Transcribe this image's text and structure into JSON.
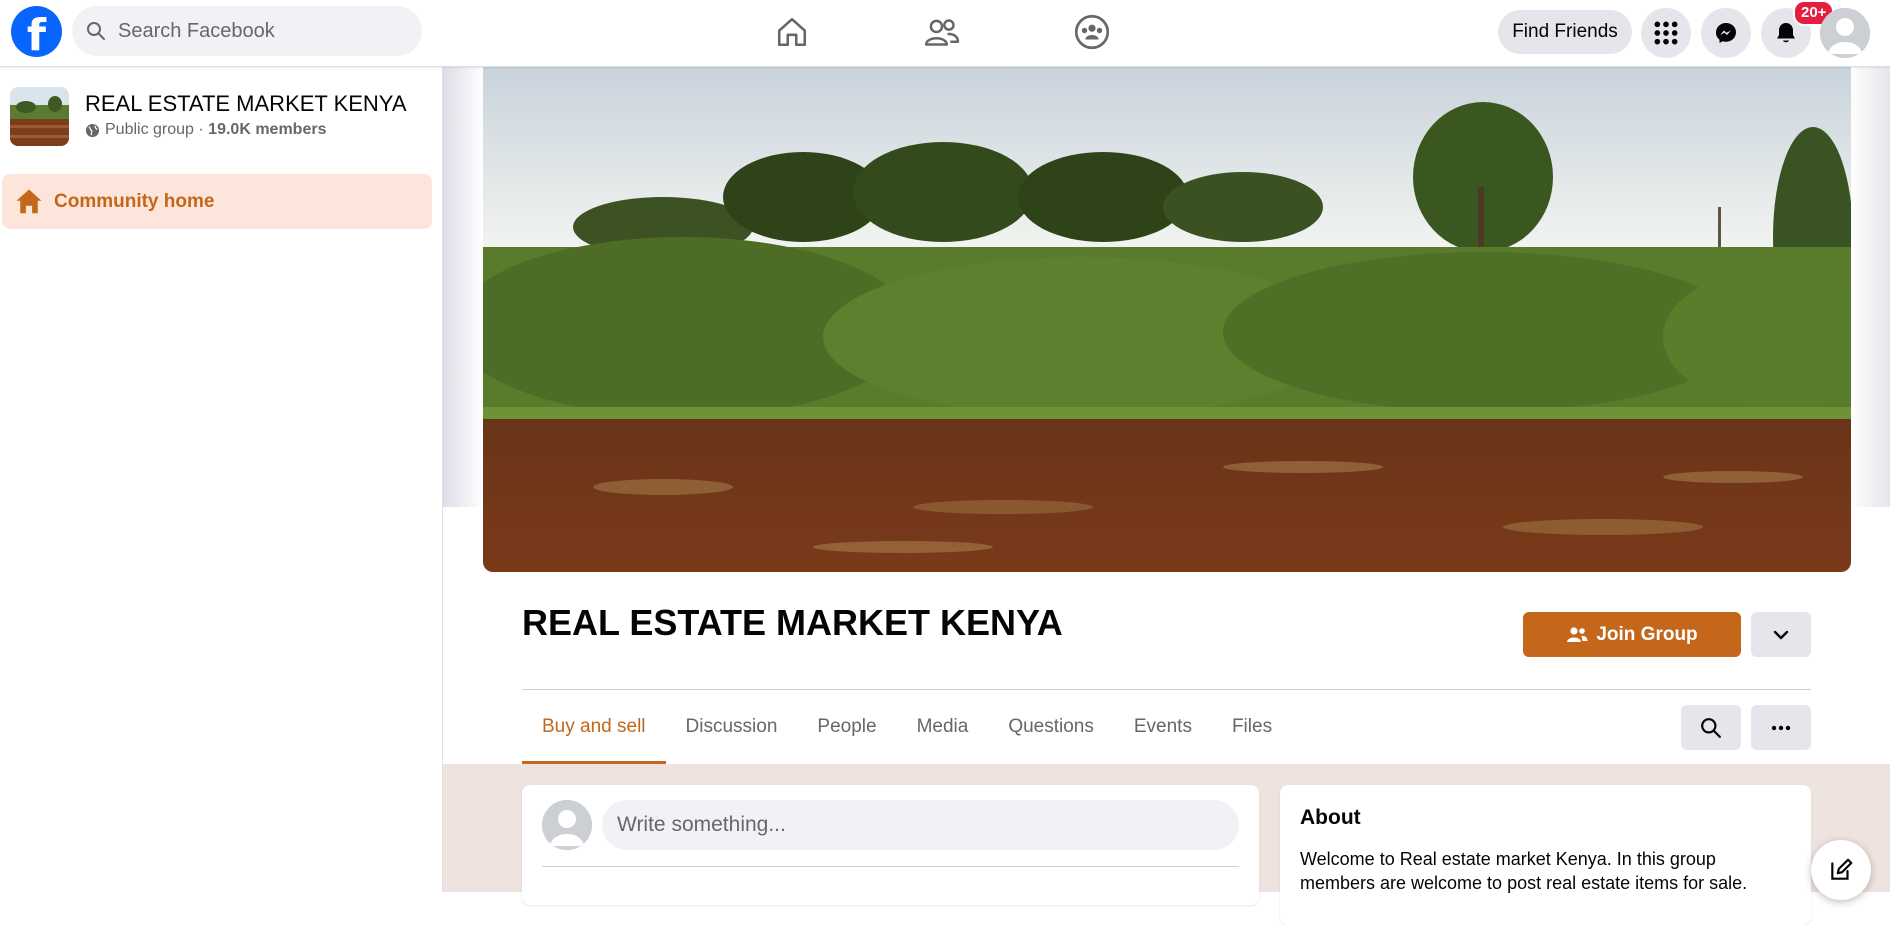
{
  "topbar": {
    "logo": "f",
    "search_placeholder": "Search Facebook",
    "nav_icons": [
      "home-icon",
      "friends-icon",
      "groups-icon"
    ],
    "find_friends_label": "Find Friends",
    "notification_badge": "20+"
  },
  "sidebar": {
    "group_name": "REAL ESTATE MARKET KENYA",
    "group_privacy": "Public group",
    "separator": " · ",
    "member_count": "19.0K members",
    "nav_item_label": "Community home"
  },
  "header": {
    "title": "REAL ESTATE MARKET KENYA",
    "join_label": "Join Group"
  },
  "tabs": [
    {
      "label": "Buy and sell",
      "active": true
    },
    {
      "label": "Discussion",
      "active": false
    },
    {
      "label": "People",
      "active": false
    },
    {
      "label": "Media",
      "active": false
    },
    {
      "label": "Questions",
      "active": false
    },
    {
      "label": "Events",
      "active": false
    },
    {
      "label": "Files",
      "active": false
    }
  ],
  "composer": {
    "placeholder": "Write something..."
  },
  "about": {
    "title": "About",
    "text": "Welcome to Real estate market Kenya. In this group members are welcome to post real estate items for sale."
  },
  "colors": {
    "accent": "#c4671a",
    "accent_bg": "#fde5dc",
    "facebook_blue": "#0866ff",
    "badge_red": "#e41e3f"
  }
}
